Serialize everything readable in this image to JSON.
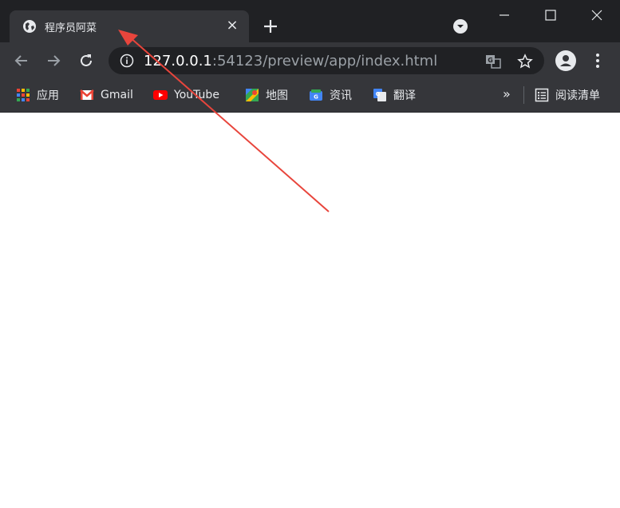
{
  "tab": {
    "title": "程序员阿菜",
    "favicon": "globe-icon",
    "close": "×"
  },
  "address": {
    "host": "127.0.0.1",
    "rest": ":54123/preview/app/index.html"
  },
  "bookmarks": [
    {
      "label": "应用",
      "icon": "apps-grid-icon"
    },
    {
      "label": "Gmail",
      "icon": "gmail-icon"
    },
    {
      "label": "YouTube",
      "icon": "youtube-icon"
    },
    {
      "label": "地图",
      "icon": "maps-icon"
    },
    {
      "label": "资讯",
      "icon": "news-icon"
    },
    {
      "label": "翻译",
      "icon": "translate-icon"
    }
  ],
  "overflow": "»",
  "reading_list": "阅读清单",
  "colors": {
    "titlebar": "#202124",
    "toolbar": "#35363a",
    "annotation_arrow": "#e8453c"
  }
}
